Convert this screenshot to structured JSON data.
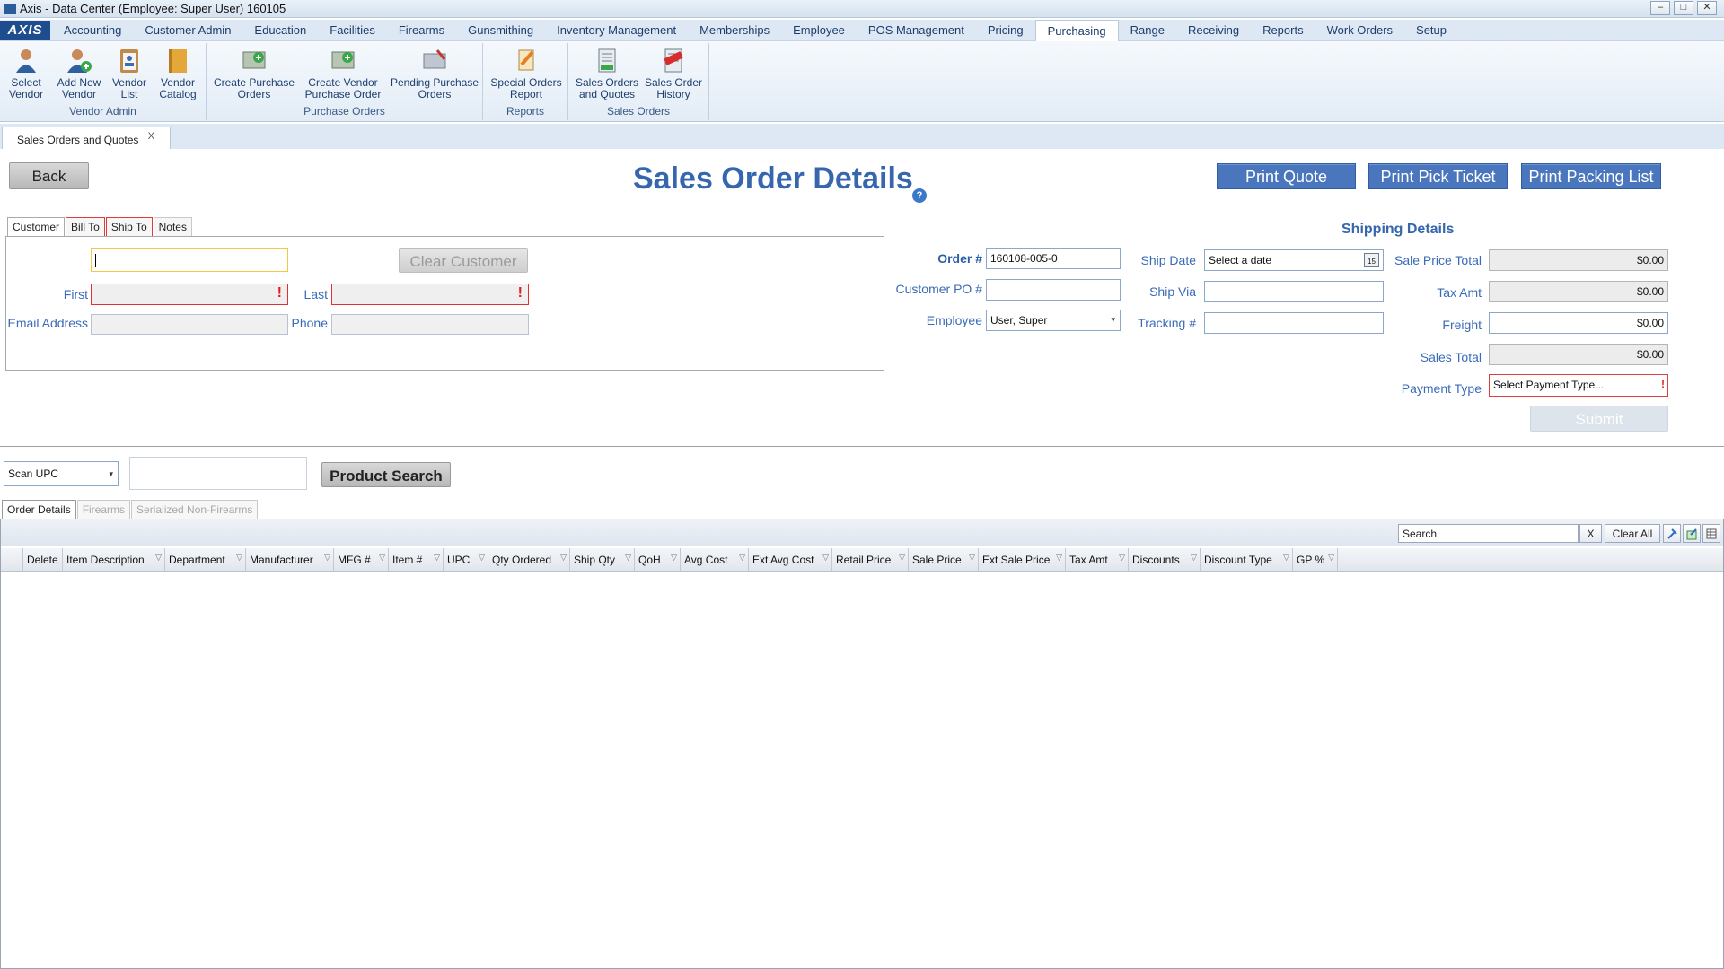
{
  "window": {
    "title": "Axis - Data Center  (Employee: Super User) 160105",
    "controls": [
      "–",
      "□",
      "✕"
    ]
  },
  "logo": "AXIS",
  "menu": {
    "tabs": [
      "Accounting",
      "Customer Admin",
      "Education",
      "Facilities",
      "Firearms",
      "Gunsmithing",
      "Inventory Management",
      "Memberships",
      "Employee",
      "POS Management",
      "Pricing",
      "Purchasing",
      "Range",
      "Receiving",
      "Reports",
      "Work Orders",
      "Setup"
    ],
    "active": "Purchasing"
  },
  "ribbon": {
    "groups": [
      {
        "label": "Vendor Admin",
        "buttons": [
          {
            "line1": "Select",
            "line2": "Vendor",
            "icon": "person-icon"
          },
          {
            "line1": "Add New",
            "line2": "Vendor",
            "icon": "add-person-icon"
          },
          {
            "line1": "Vendor",
            "line2": "List",
            "icon": "clipboard-icon"
          },
          {
            "line1": "Vendor",
            "line2": "Catalog",
            "icon": "catalog-icon"
          }
        ]
      },
      {
        "label": "Purchase Orders",
        "buttons": [
          {
            "line1": "Create Purchase",
            "line2": "Orders",
            "icon": "create-po-icon"
          },
          {
            "line1": "Create Vendor",
            "line2": "Purchase Order",
            "icon": "create-vendor-po-icon"
          },
          {
            "line1": "Pending Purchase",
            "line2": "Orders",
            "icon": "pending-po-icon"
          }
        ]
      },
      {
        "label": "Reports",
        "buttons": [
          {
            "line1": "Special Orders",
            "line2": "Report",
            "icon": "report-icon"
          }
        ]
      },
      {
        "label": "Sales Orders",
        "buttons": [
          {
            "line1": "Sales Orders",
            "line2": "and Quotes",
            "icon": "sales-orders-icon"
          },
          {
            "line1": "Sales Order",
            "line2": "History",
            "icon": "paid-icon"
          }
        ]
      }
    ]
  },
  "doc_tab": {
    "label": "Sales Orders and Quotes",
    "close": "X"
  },
  "page": {
    "back": "Back",
    "title": "Sales Order Details",
    "help": "?",
    "print_quote": "Print Quote",
    "print_pick": "Print Pick Ticket",
    "print_packing": "Print Packing List"
  },
  "customer_tabs": [
    "Customer",
    "Bill To",
    "Ship To",
    "Notes"
  ],
  "customer": {
    "clear": "Clear Customer",
    "first_label": "First",
    "last_label": "Last",
    "email_label": "Email Address",
    "phone_label": "Phone",
    "error_mark": "!"
  },
  "order": {
    "order_label": "Order #",
    "order_value": "160108-005-0",
    "po_label": "Customer PO #",
    "employee_label": "Employee",
    "employee_value": "User, Super",
    "ship_date_label": "Ship Date",
    "ship_date_placeholder": "Select a date",
    "ship_via_label": "Ship Via",
    "tracking_label": "Tracking #"
  },
  "shipping": {
    "heading": "Shipping Details",
    "sale_price_total_label": "Sale Price Total",
    "sale_price_total": "$0.00",
    "tax_label": "Tax Amt",
    "tax": "$0.00",
    "freight_label": "Freight",
    "freight": "$0.00",
    "sales_total_label": "Sales Total",
    "sales_total": "$0.00",
    "payment_label": "Payment Type",
    "payment_placeholder": "Select Payment Type...",
    "submit": "Submit"
  },
  "scan": {
    "mode": "Scan UPC",
    "product_search": "Product Search"
  },
  "order_tabs": [
    "Order Details",
    "Firearms",
    "Serialized Non-Firearms"
  ],
  "grid": {
    "search_placeholder": "Search",
    "clear_x": "X",
    "clear_all": "Clear All",
    "columns": [
      "",
      "Delete",
      "Item Description",
      "Department",
      "Manufacturer",
      "MFG #",
      "Item #",
      "UPC",
      "Qty Ordered",
      "Ship Qty",
      "QoH",
      "Avg Cost",
      "Ext Avg Cost",
      "Retail Price",
      "Sale Price",
      "Ext Sale Price",
      "Tax Amt",
      "Discounts",
      "Discount Type",
      "GP %"
    ]
  }
}
